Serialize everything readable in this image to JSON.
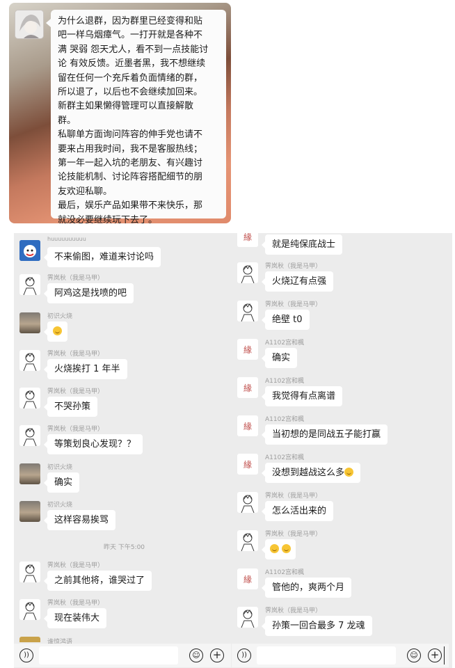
{
  "top_message": {
    "text": "为什么退群，因为群里已经变得和贴\n吧一样乌烟瘴气。一打开就是各种不\n满 哭弱 怨天尤人，看不到一点技能讨\n论 有效反馈。近墨者黑，我不想继续\n留在任何一个充斥着负面情绪的群，\n所以退了，以后也不会继续加回来。\n新群主如果懒得管理可以直接解散\n群。\n私聊单方面询问阵容的伸手党也请不\n要来占用我时间，我不是客服热线；\n第一年一起入坑的老朋友、有兴趣讨\n论技能机制、讨论阵容搭配细节的朋\n友欢迎私聊。\n最后，娱乐产品如果带不来快乐，那\n就没必要继续玩下去了。"
  },
  "left_chat": {
    "cut_name": "huuuuuuuuuu",
    "messages": [
      {
        "name": "",
        "text": "不来偷图，难道来讨论吗"
      },
      {
        "name": "霁岚秋（我是马甲）",
        "text": "阿鸡这是找喷的吧"
      },
      {
        "name": "初识火烧",
        "text": ""
      },
      {
        "name": "霁岚秋（我是马甲）",
        "text": "火烧挨打 1 年半"
      },
      {
        "name": "霁岚秋（我是马甲）",
        "text": "不哭孙策"
      },
      {
        "name": "霁岚秋（我是马甲）",
        "text": "等策划良心发现？？"
      },
      {
        "name": "初识火烧",
        "text": "确实"
      },
      {
        "name": "初识火烧",
        "text": "这样容易挨骂"
      },
      {
        "name": "霁岚秋（我是马甲）",
        "text": "之前其他将，谁哭过了"
      },
      {
        "name": "霁岚秋（我是马甲）",
        "text": "现在装伟大"
      }
    ],
    "timestamp": "昨天 下午5:00",
    "cut_bottom_name": "谁惊鸿语"
  },
  "right_chat": {
    "messages": [
      {
        "name": "",
        "text": "就是纯保底战士"
      },
      {
        "name": "霁岚秋（我是马甲）",
        "text": "火烧辽有点强"
      },
      {
        "name": "霁岚秋（我是马甲）",
        "text": "绝壁 t0"
      },
      {
        "name": "A1102宫和楓",
        "text": "确实"
      },
      {
        "name": "A1102宫和楓",
        "text": "我觉得有点离谱"
      },
      {
        "name": "A1102宫和楓",
        "text": "当初想的是同战五子能打赢"
      },
      {
        "name": "A1102宫和楓",
        "text": "没想到越战这么多"
      },
      {
        "name": "霁岚秋（我是马甲）",
        "text": "怎么活出来的"
      },
      {
        "name": "霁岚秋（我是马甲）",
        "text": ""
      },
      {
        "name": "A1102宫和楓",
        "text": "管他的，爽两个月"
      },
      {
        "name": "霁岚秋（我是马甲）",
        "text": "孙策一回合最多 7 龙魂"
      }
    ]
  },
  "icons": [
    "voice-icon",
    "emoji-icon",
    "plus-icon",
    "laugh-emoji-icon"
  ]
}
